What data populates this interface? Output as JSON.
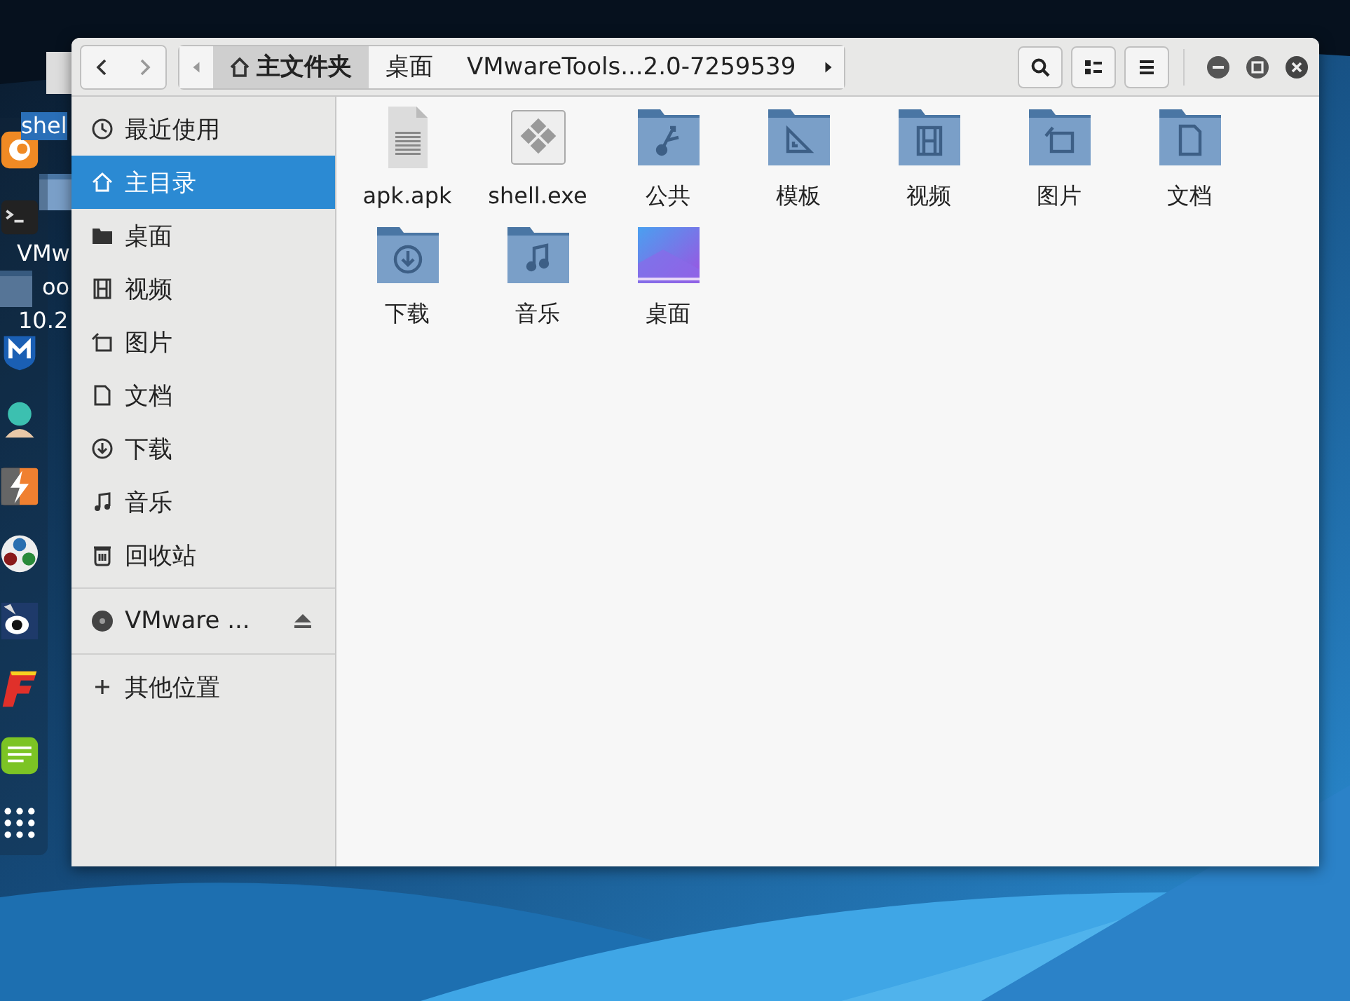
{
  "desktop": {
    "icons": [
      {
        "label": "shel",
        "selected": true
      },
      {
        "label": "VMw",
        "selected": false
      },
      {
        "label": "oo",
        "selected": false
      },
      {
        "label": "10.2",
        "selected": false
      }
    ]
  },
  "window": {
    "pathbar": [
      {
        "label": "主文件夹",
        "selected": true
      },
      {
        "label": "桌面",
        "selected": false
      },
      {
        "label": "VMwareTools...2.0-7259539",
        "selected": false
      }
    ]
  },
  "sidebar": {
    "places": [
      {
        "label": "最近使用",
        "selected": false
      },
      {
        "label": "主目录",
        "selected": true
      },
      {
        "label": "桌面",
        "selected": false
      },
      {
        "label": "视频",
        "selected": false
      },
      {
        "label": "图片",
        "selected": false
      },
      {
        "label": "文档",
        "selected": false
      },
      {
        "label": "下载",
        "selected": false
      },
      {
        "label": "音乐",
        "selected": false
      },
      {
        "label": "回收站",
        "selected": false
      }
    ],
    "devices": [
      {
        "label": "VMware ...",
        "selected": false
      }
    ],
    "other": {
      "label": "其他位置"
    }
  },
  "files": [
    {
      "name": "apk.apk",
      "kind": "document"
    },
    {
      "name": "shell.exe",
      "kind": "exe"
    },
    {
      "name": "公共",
      "kind": "folder"
    },
    {
      "name": "模板",
      "kind": "folder"
    },
    {
      "name": "视频",
      "kind": "folder"
    },
    {
      "name": "图片",
      "kind": "folder"
    },
    {
      "name": "文档",
      "kind": "folder"
    },
    {
      "name": "下载",
      "kind": "folder"
    },
    {
      "name": "音乐",
      "kind": "folder"
    },
    {
      "name": "桌面",
      "kind": "desktop"
    }
  ]
}
